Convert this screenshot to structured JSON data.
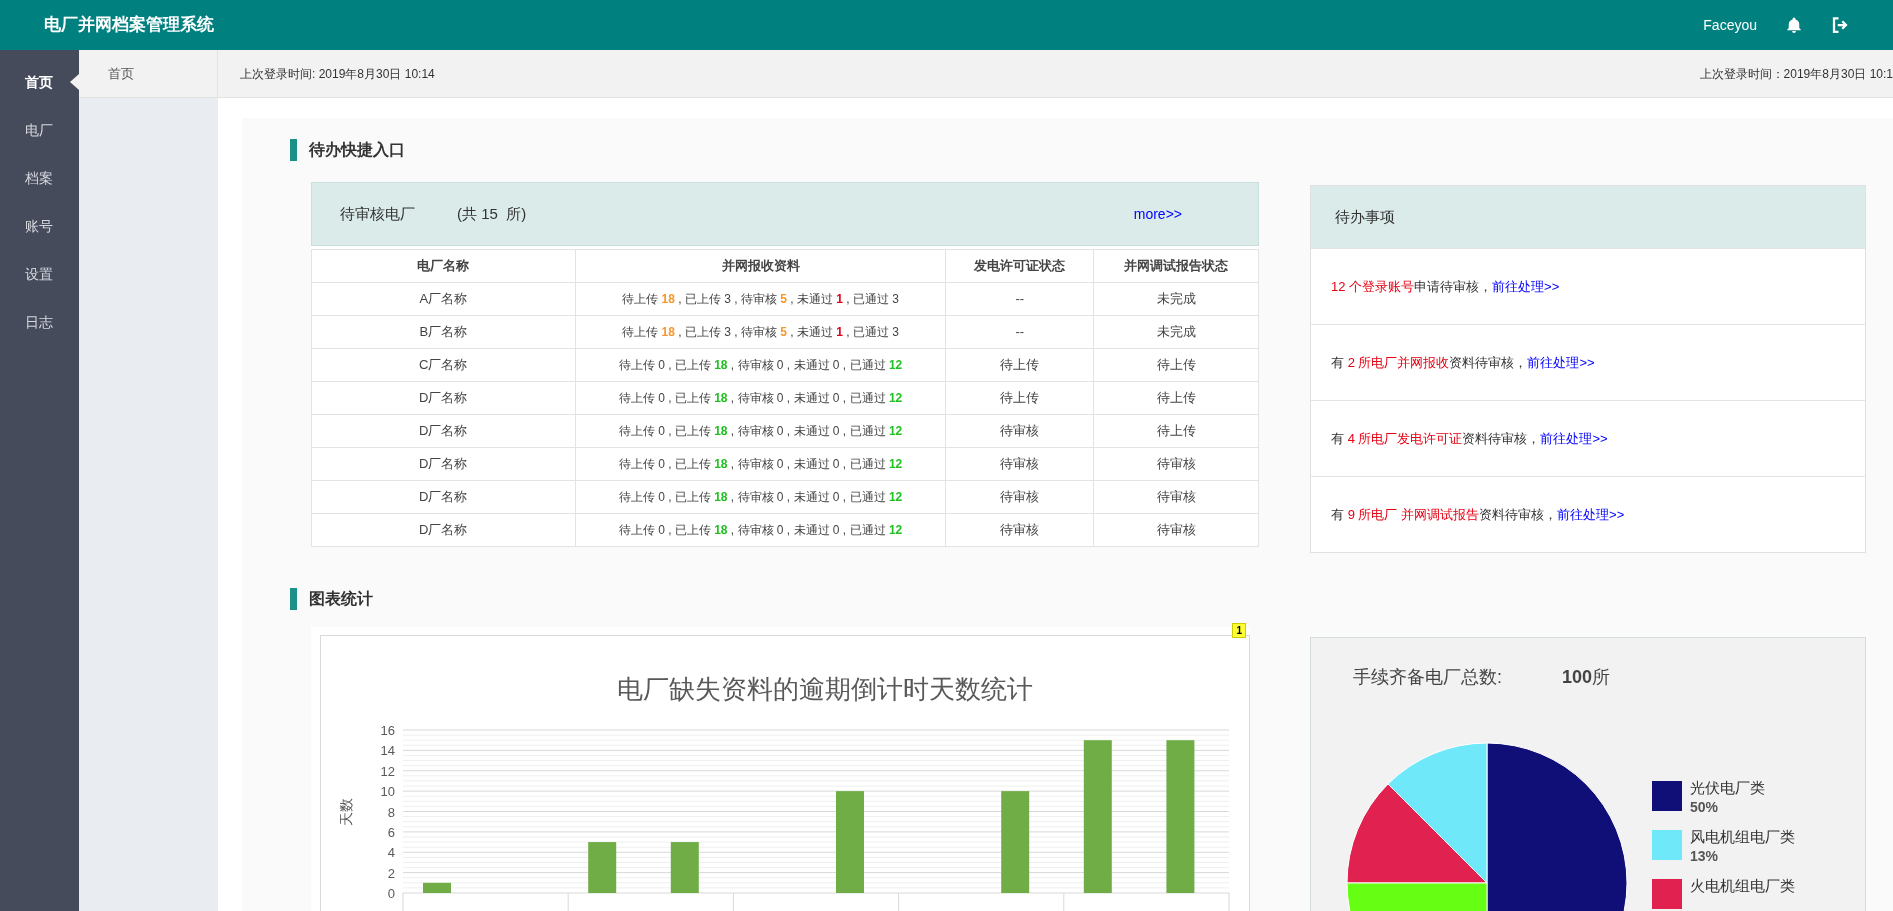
{
  "header": {
    "title": "电厂并网档案管理系统",
    "user": "Faceyou"
  },
  "sidebar": {
    "items": [
      {
        "label": "首页",
        "selected": true
      },
      {
        "label": "电厂",
        "selected": false
      },
      {
        "label": "档案",
        "selected": false
      },
      {
        "label": "账号",
        "selected": false
      },
      {
        "label": "设置",
        "selected": false
      },
      {
        "label": "日志",
        "selected": false
      }
    ]
  },
  "subnav": {
    "tab": "首页"
  },
  "login_bar": {
    "left": "上次登录时间: 2019年8月30日 10:14",
    "right": "上次登录时间：2019年8月30日 10:1"
  },
  "todo_section": {
    "title": "待办快捷入口",
    "plants_card": {
      "title": "待审核电厂",
      "count": "(共 15  所)",
      "more": "more>>",
      "columns": [
        "电厂名称",
        "并网报收资料",
        "发电许可证状态",
        "并网调试报告状态"
      ],
      "rows": [
        {
          "name": "A厂名称",
          "materials": [
            {
              "text": "待上传 ",
              "kind": "plain"
            },
            {
              "text": "18",
              "kind": "warn"
            },
            {
              "text": " , 已上传 3 , 待审核 ",
              "kind": "plain"
            },
            {
              "text": "5",
              "kind": "warn"
            },
            {
              "text": " , 未通过 ",
              "kind": "plain"
            },
            {
              "text": "1",
              "kind": "error"
            },
            {
              "text": " , 已通过 3",
              "kind": "plain"
            }
          ],
          "license": "--",
          "report": "未完成"
        },
        {
          "name": "B厂名称",
          "materials": [
            {
              "text": "待上传 ",
              "kind": "plain"
            },
            {
              "text": "18",
              "kind": "warn"
            },
            {
              "text": " , 已上传 3 , 待审核 ",
              "kind": "plain"
            },
            {
              "text": "5",
              "kind": "warn"
            },
            {
              "text": " , 未通过 ",
              "kind": "plain"
            },
            {
              "text": "1",
              "kind": "error"
            },
            {
              "text": " , 已通过 3",
              "kind": "plain"
            }
          ],
          "license": "--",
          "report": "未完成"
        },
        {
          "name": "C厂名称",
          "materials": [
            {
              "text": "待上传 0 , 已上传 ",
              "kind": "plain"
            },
            {
              "text": "18",
              "kind": "ok"
            },
            {
              "text": " , 待审核 0 , 未通过 0 , 已通过 ",
              "kind": "plain"
            },
            {
              "text": "12",
              "kind": "ok"
            }
          ],
          "license": "待上传",
          "report": "待上传"
        },
        {
          "name": "D厂名称",
          "materials": [
            {
              "text": "待上传 0 , 已上传 ",
              "kind": "plain"
            },
            {
              "text": "18",
              "kind": "ok"
            },
            {
              "text": " , 待审核 0 , 未通过 0 , 已通过 ",
              "kind": "plain"
            },
            {
              "text": "12",
              "kind": "ok"
            }
          ],
          "license": "待上传",
          "report": "待上传"
        },
        {
          "name": "D厂名称",
          "materials": [
            {
              "text": "待上传 0 , 已上传 ",
              "kind": "plain"
            },
            {
              "text": "18",
              "kind": "ok"
            },
            {
              "text": " , 待审核 0 , 未通过 0 , 已通过 ",
              "kind": "plain"
            },
            {
              "text": "12",
              "kind": "ok"
            }
          ],
          "license": "待审核",
          "report": "待上传"
        },
        {
          "name": "D厂名称",
          "materials": [
            {
              "text": "待上传 0 , 已上传 ",
              "kind": "plain"
            },
            {
              "text": "18",
              "kind": "ok"
            },
            {
              "text": " , 待审核 0 , 未通过 0 , 已通过 ",
              "kind": "plain"
            },
            {
              "text": "12",
              "kind": "ok"
            }
          ],
          "license": "待审核",
          "report": "待审核"
        },
        {
          "name": "D厂名称",
          "materials": [
            {
              "text": "待上传 0 , 已上传 ",
              "kind": "plain"
            },
            {
              "text": "18",
              "kind": "ok"
            },
            {
              "text": " , 待审核 0 , 未通过 0 , 已通过 ",
              "kind": "plain"
            },
            {
              "text": "12",
              "kind": "ok"
            }
          ],
          "license": "待审核",
          "report": "待审核"
        },
        {
          "name": "D厂名称",
          "materials": [
            {
              "text": "待上传 0 , 已上传 ",
              "kind": "plain"
            },
            {
              "text": "18",
              "kind": "ok"
            },
            {
              "text": " , 待审核 0 , 未通过 0 , 已通过 ",
              "kind": "plain"
            },
            {
              "text": "12",
              "kind": "ok"
            }
          ],
          "license": "待审核",
          "report": "待审核"
        }
      ]
    },
    "tasks_card": {
      "title": "待办事项",
      "items": [
        {
          "parts": [
            {
              "text": "12 个登录账号",
              "kind": "highlight"
            },
            {
              "text": "申请待审核，",
              "kind": "plain"
            }
          ],
          "link": "前往处理>>"
        },
        {
          "parts": [
            {
              "text": "有 ",
              "kind": "plain"
            },
            {
              "text": "2 所电厂并网报收",
              "kind": "highlight"
            },
            {
              "text": "资料待审核，",
              "kind": "plain"
            }
          ],
          "link": "前往处理>>"
        },
        {
          "parts": [
            {
              "text": "有 ",
              "kind": "plain"
            },
            {
              "text": "4 所电厂发电许可证",
              "kind": "highlight"
            },
            {
              "text": "资料待审核，",
              "kind": "plain"
            }
          ],
          "link": "前往处理>>"
        },
        {
          "parts": [
            {
              "text": "有 ",
              "kind": "plain"
            },
            {
              "text": "9 所电厂 并网调试报告",
              "kind": "highlight"
            },
            {
              "text": "资料待审核，",
              "kind": "plain"
            }
          ],
          "link": "前往处理>>"
        }
      ]
    }
  },
  "chart_section": {
    "title": "图表统计",
    "badge": "1",
    "bar_chart": {
      "chart_data": {
        "type": "bar",
        "title": "电厂缺失资料的逾期倒计时天数统计",
        "ylabel": "天数",
        "values": [
          1,
          null,
          5,
          5,
          null,
          10,
          null,
          10,
          15,
          15
        ],
        "ylim": [
          0,
          16
        ],
        "grid": true,
        "yticks": [
          0,
          2,
          4,
          6,
          8,
          10,
          12,
          14,
          16
        ]
      }
    },
    "pie_card": {
      "title": "手续齐备电厂总数:",
      "total": "100",
      "unit": "所",
      "chart_data": {
        "type": "pie",
        "values": [
          50,
          12.5,
          12.5,
          25
        ],
        "colors": [
          "#100e77",
          "#6fe9f9",
          "#e1214f",
          "#66ff14"
        ]
      },
      "legend": [
        {
          "label": "光伏电厂类",
          "percent": "50%",
          "color": "#100e77"
        },
        {
          "label": "风电机组电厂类",
          "percent": "13%",
          "color": "#6fe9f9"
        },
        {
          "label": "火电机组电厂类",
          "color": "#e1214f"
        }
      ]
    }
  }
}
